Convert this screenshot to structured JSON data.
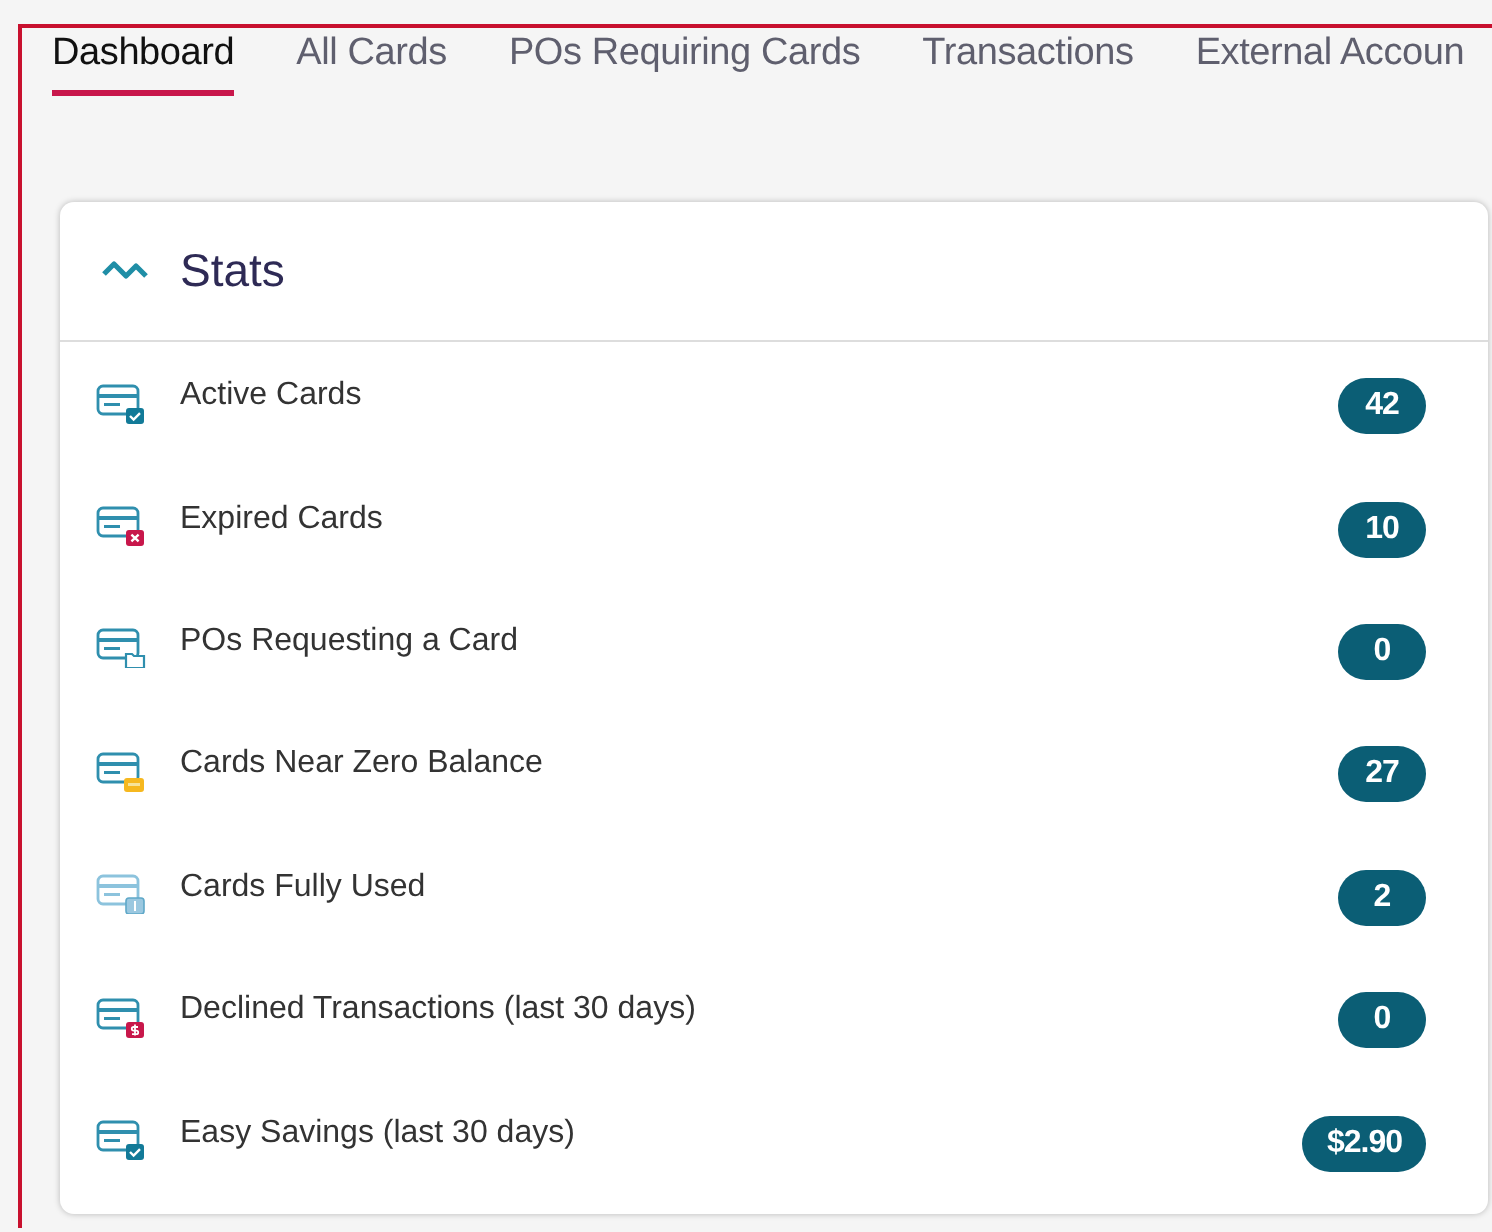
{
  "tabs": [
    {
      "label": "Dashboard",
      "selected": true
    },
    {
      "label": "All Cards",
      "selected": false
    },
    {
      "label": "POs Requiring Cards",
      "selected": false
    },
    {
      "label": "Transactions",
      "selected": false
    },
    {
      "label": "External Accoun",
      "selected": false
    }
  ],
  "stats_card": {
    "title": "Stats",
    "items": [
      {
        "kind": "check",
        "label": "Active Cards",
        "value": "42"
      },
      {
        "kind": "expired",
        "label": "Expired Cards",
        "value": "10"
      },
      {
        "kind": "folder",
        "label": "POs Requesting a Card",
        "value": "0"
      },
      {
        "kind": "low",
        "label": "Cards Near Zero Balance",
        "value": "27"
      },
      {
        "kind": "used",
        "label": "Cards Fully Used",
        "value": "2"
      },
      {
        "kind": "declined",
        "label": "Declined Transactions (last 30 days)",
        "value": "0"
      },
      {
        "kind": "check",
        "label": "Easy Savings (last 30 days)",
        "value": "$2.90"
      }
    ]
  }
}
